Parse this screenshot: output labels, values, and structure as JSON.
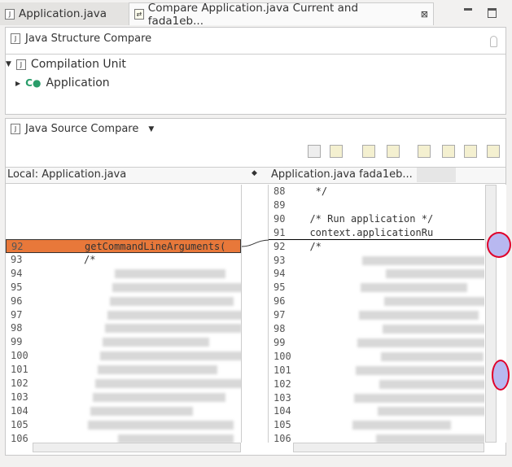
{
  "tabs": [
    {
      "label": "Application.java",
      "active": false
    },
    {
      "label": "Compare Application.java Current and fada1eb...",
      "active": true
    }
  ],
  "structure": {
    "title": "Java Structure Compare",
    "tree": [
      {
        "label": "Compilation Unit",
        "expanded": true
      },
      {
        "label": "Application",
        "expanded": false
      }
    ]
  },
  "source": {
    "title": "Java Source Compare",
    "left_title": "Local: Application.java",
    "right_title": "Application.java fada1eb...",
    "left_lines": [
      {
        "n": "92",
        "text": "getCommandLineArguments(",
        "changed": true
      },
      {
        "n": "93",
        "text": "/*"
      },
      {
        "n": "94"
      },
      {
        "n": "95"
      },
      {
        "n": "96"
      },
      {
        "n": "97"
      },
      {
        "n": "98"
      },
      {
        "n": "99"
      },
      {
        "n": "100"
      },
      {
        "n": "101"
      },
      {
        "n": "102"
      },
      {
        "n": "103"
      },
      {
        "n": "104"
      },
      {
        "n": "105"
      },
      {
        "n": "106"
      }
    ],
    "right_lines": [
      {
        "n": "88",
        "text": "   */"
      },
      {
        "n": "89",
        "text": ""
      },
      {
        "n": "90",
        "text": "  /* Run application */"
      },
      {
        "n": "91",
        "text": "  context.applicationRu"
      },
      {
        "n": "92",
        "text": "  /*"
      },
      {
        "n": "93"
      },
      {
        "n": "94"
      },
      {
        "n": "95"
      },
      {
        "n": "96"
      },
      {
        "n": "97"
      },
      {
        "n": "98"
      },
      {
        "n": "99"
      },
      {
        "n": "100"
      },
      {
        "n": "101"
      },
      {
        "n": "102"
      },
      {
        "n": "103"
      },
      {
        "n": "104"
      },
      {
        "n": "105"
      },
      {
        "n": "106"
      }
    ]
  },
  "colors": {
    "change": "#e8783a",
    "highlight_ring": "#e0002a"
  }
}
